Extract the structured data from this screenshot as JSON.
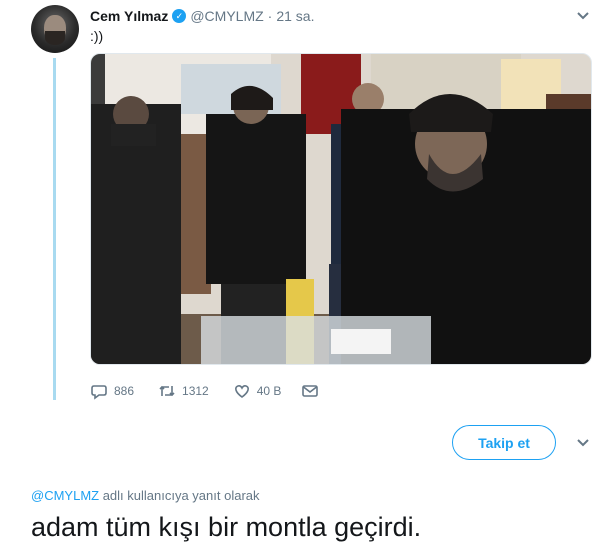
{
  "tweet": {
    "name": "Cem Yılmaz",
    "handle": "@CMYLMZ",
    "separator": "·",
    "time": "21 sa.",
    "text": ":))",
    "actions": {
      "replies": "886",
      "retweets": "1312",
      "likes": "40 B"
    }
  },
  "reply": {
    "follow_label": "Takip et",
    "context_mention": "@CMYLMZ",
    "context_suffix": " adlı kullanıcıya yanıt olarak",
    "text": "adam tüm kışı bir montla geçirdi."
  },
  "colors": {
    "accent": "#1da1f2",
    "muted": "#657786",
    "thread": "#a8daf0"
  },
  "icons": [
    "verified-badge-icon",
    "chevron-down-icon",
    "reply-icon",
    "retweet-icon",
    "like-icon",
    "message-icon"
  ]
}
